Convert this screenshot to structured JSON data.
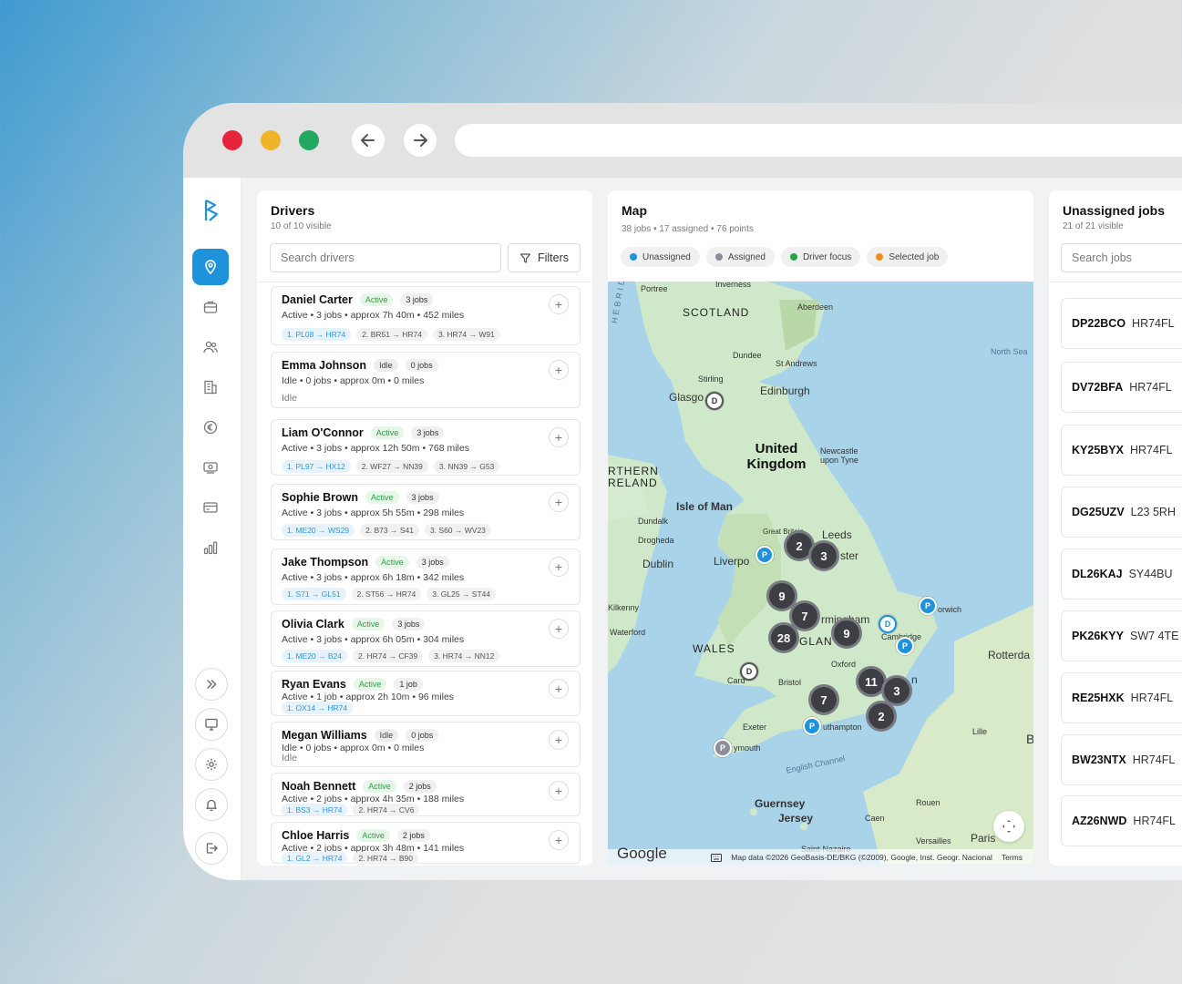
{
  "drivers_panel": {
    "title": "Drivers",
    "subtitle": "10 of 10 visible",
    "search_placeholder": "Search drivers",
    "filters_label": "Filters",
    "drivers": [
      {
        "name": "Daniel Carter",
        "status": "Active",
        "jobs": "3 jobs",
        "meta": "Active • 3 jobs • approx 7h 40m • 452 miles",
        "routes": [
          "1. PL08 → HR74",
          "2. BR51 → HR74",
          "3. HR74 → W91"
        ]
      },
      {
        "name": "Emma Johnson",
        "status": "Idle",
        "jobs": "0 jobs",
        "meta": "Idle • 0 jobs • approx 0m • 0 miles",
        "idle_note": "Idle",
        "routes": []
      },
      {
        "name": "Liam O'Connor",
        "status": "Active",
        "jobs": "3 jobs",
        "meta": "Active • 3 jobs • approx 12h 50m • 768 miles",
        "routes": [
          "1. PL97 → HX12",
          "2. WF27 → NN39",
          "3. NN39 → G53"
        ]
      },
      {
        "name": "Sophie Brown",
        "status": "Active",
        "jobs": "3 jobs",
        "meta": "Active • 3 jobs • approx 5h 55m • 298 miles",
        "routes": [
          "1. ME20 → WS29",
          "2. B73 → S41",
          "3. S60 → WV23"
        ]
      },
      {
        "name": "Jake Thompson",
        "status": "Active",
        "jobs": "3 jobs",
        "meta": "Active • 3 jobs • approx 6h 18m • 342 miles",
        "routes": [
          "1. S71 → GL51",
          "2. ST56 → HR74",
          "3. GL25 → ST44"
        ]
      },
      {
        "name": "Olivia Clark",
        "status": "Active",
        "jobs": "3 jobs",
        "meta": "Active • 3 jobs • approx 6h 05m • 304 miles",
        "routes": [
          "1. ME20 → B24",
          "2. HR74 → CF39",
          "3. HR74 → NN12"
        ]
      },
      {
        "name": "Ryan Evans",
        "status": "Active",
        "jobs": "1 job",
        "meta": "Active • 1 job • approx 2h 10m • 96 miles",
        "routes": [
          "1. OX14 → HR74"
        ]
      },
      {
        "name": "Megan Williams",
        "status": "Idle",
        "jobs": "0 jobs",
        "meta": "Idle • 0 jobs • approx 0m • 0 miles",
        "idle_note": "Idle",
        "routes": []
      },
      {
        "name": "Noah Bennett",
        "status": "Active",
        "jobs": "2 jobs",
        "meta": "Active • 2 jobs • approx 4h 35m • 188 miles",
        "routes": [
          "1. BS3 → HR74",
          "2. HR74 → CV6"
        ]
      },
      {
        "name": "Chloe Harris",
        "status": "Active",
        "jobs": "2 jobs",
        "meta": "Active • 2 jobs • approx 3h 48m • 141 miles",
        "routes": [
          "1. GL2 → HR74",
          "2. HR74 → B90"
        ]
      }
    ]
  },
  "map_panel": {
    "title": "Map",
    "subtitle": "38 jobs • 17 assigned • 76 points",
    "legend": [
      {
        "label": "Unassigned",
        "color": "#1e93db"
      },
      {
        "label": "Assigned",
        "color": "#8c8f98"
      },
      {
        "label": "Driver focus",
        "color": "#22a64a"
      },
      {
        "label": "Selected job",
        "color": "#f28c1a"
      }
    ],
    "place_labels": {
      "portree": "Portree",
      "inverness": "Inverness",
      "scotland": "SCOTLAND",
      "aberdeen": "Aberdeen",
      "hebrides": "HEBRIDES",
      "dundee": "Dundee",
      "st_andrews": "St Andrews",
      "north_sea": "North Sea",
      "stirling": "Stirling",
      "glasgow": "Glasgo",
      "edinburgh": "Edinburgh",
      "united_kingdom": "United Kingdom",
      "newcastle": "Newcastle upon Tyne",
      "northern_ireland": "RTHERN RELAND",
      "isle_of_man": "Isle of Man",
      "dundalk": "Dundalk",
      "drogheda": "Drogheda",
      "dublin": "Dublin",
      "great_britain": "Great Britain",
      "leeds": "Leeds",
      "manchester": "ster",
      "liverpool": "Liverpo",
      "kilkenny": "Kilkenny",
      "waterford": "Waterford",
      "norwich": "orwich",
      "birmingham": "rmingham",
      "england": "GLAN",
      "cambridge": "Cambridge",
      "wales": "WALES",
      "oxford": "Oxford",
      "rotterdam": "Rotterda",
      "cardiff": "Card",
      "bristol": "Bristol",
      "london": "n",
      "exeter": "Exeter",
      "southampton": "uthampton",
      "plymouth": "ymouth",
      "lille": "Lille",
      "english_channel": "English Channel",
      "guernsey": "Guernsey",
      "jersey": "Jersey",
      "rouen": "Rouen",
      "caen": "Caen",
      "versailles": "Versailles",
      "paris": "Paris",
      "saint_nazaire": "Saint-Nazaire",
      "b_label": "B"
    },
    "clusters": [
      "2",
      "3",
      "9",
      "7",
      "28",
      "9",
      "11",
      "3",
      "7",
      "2"
    ],
    "pin_labels": {
      "driver": "D",
      "pickup": "P"
    },
    "google_label": "Google",
    "attribution": "Map data ©2026 GeoBasis-DE/BKG (©2009), Google, Inst. Geogr. Nacional",
    "terms_label": "Terms"
  },
  "jobs_panel": {
    "title": "Unassigned jobs",
    "subtitle": "21 of 21 visible",
    "search_placeholder": "Search jobs",
    "jobs": [
      {
        "reg": "DP22BCO",
        "postcode": "HR74FL"
      },
      {
        "reg": "DV72BFA",
        "postcode": "HR74FL"
      },
      {
        "reg": "KY25BYX",
        "postcode": "HR74FL"
      },
      {
        "reg": "DG25UZV",
        "postcode": "L23 5RH"
      },
      {
        "reg": "DL26KAJ",
        "postcode": "SY44BU"
      },
      {
        "reg": "PK26KYY",
        "postcode": "SW7 4TE"
      },
      {
        "reg": "RE25HXK",
        "postcode": "HR74FL"
      },
      {
        "reg": "BW23NTX",
        "postcode": "HR74FL"
      },
      {
        "reg": "AZ26NWD",
        "postcode": "HR74FL"
      }
    ]
  },
  "colors": {
    "accent": "#1e93db",
    "close": "#e5243b",
    "minimize": "#f0b429",
    "maximize": "#23a862"
  }
}
